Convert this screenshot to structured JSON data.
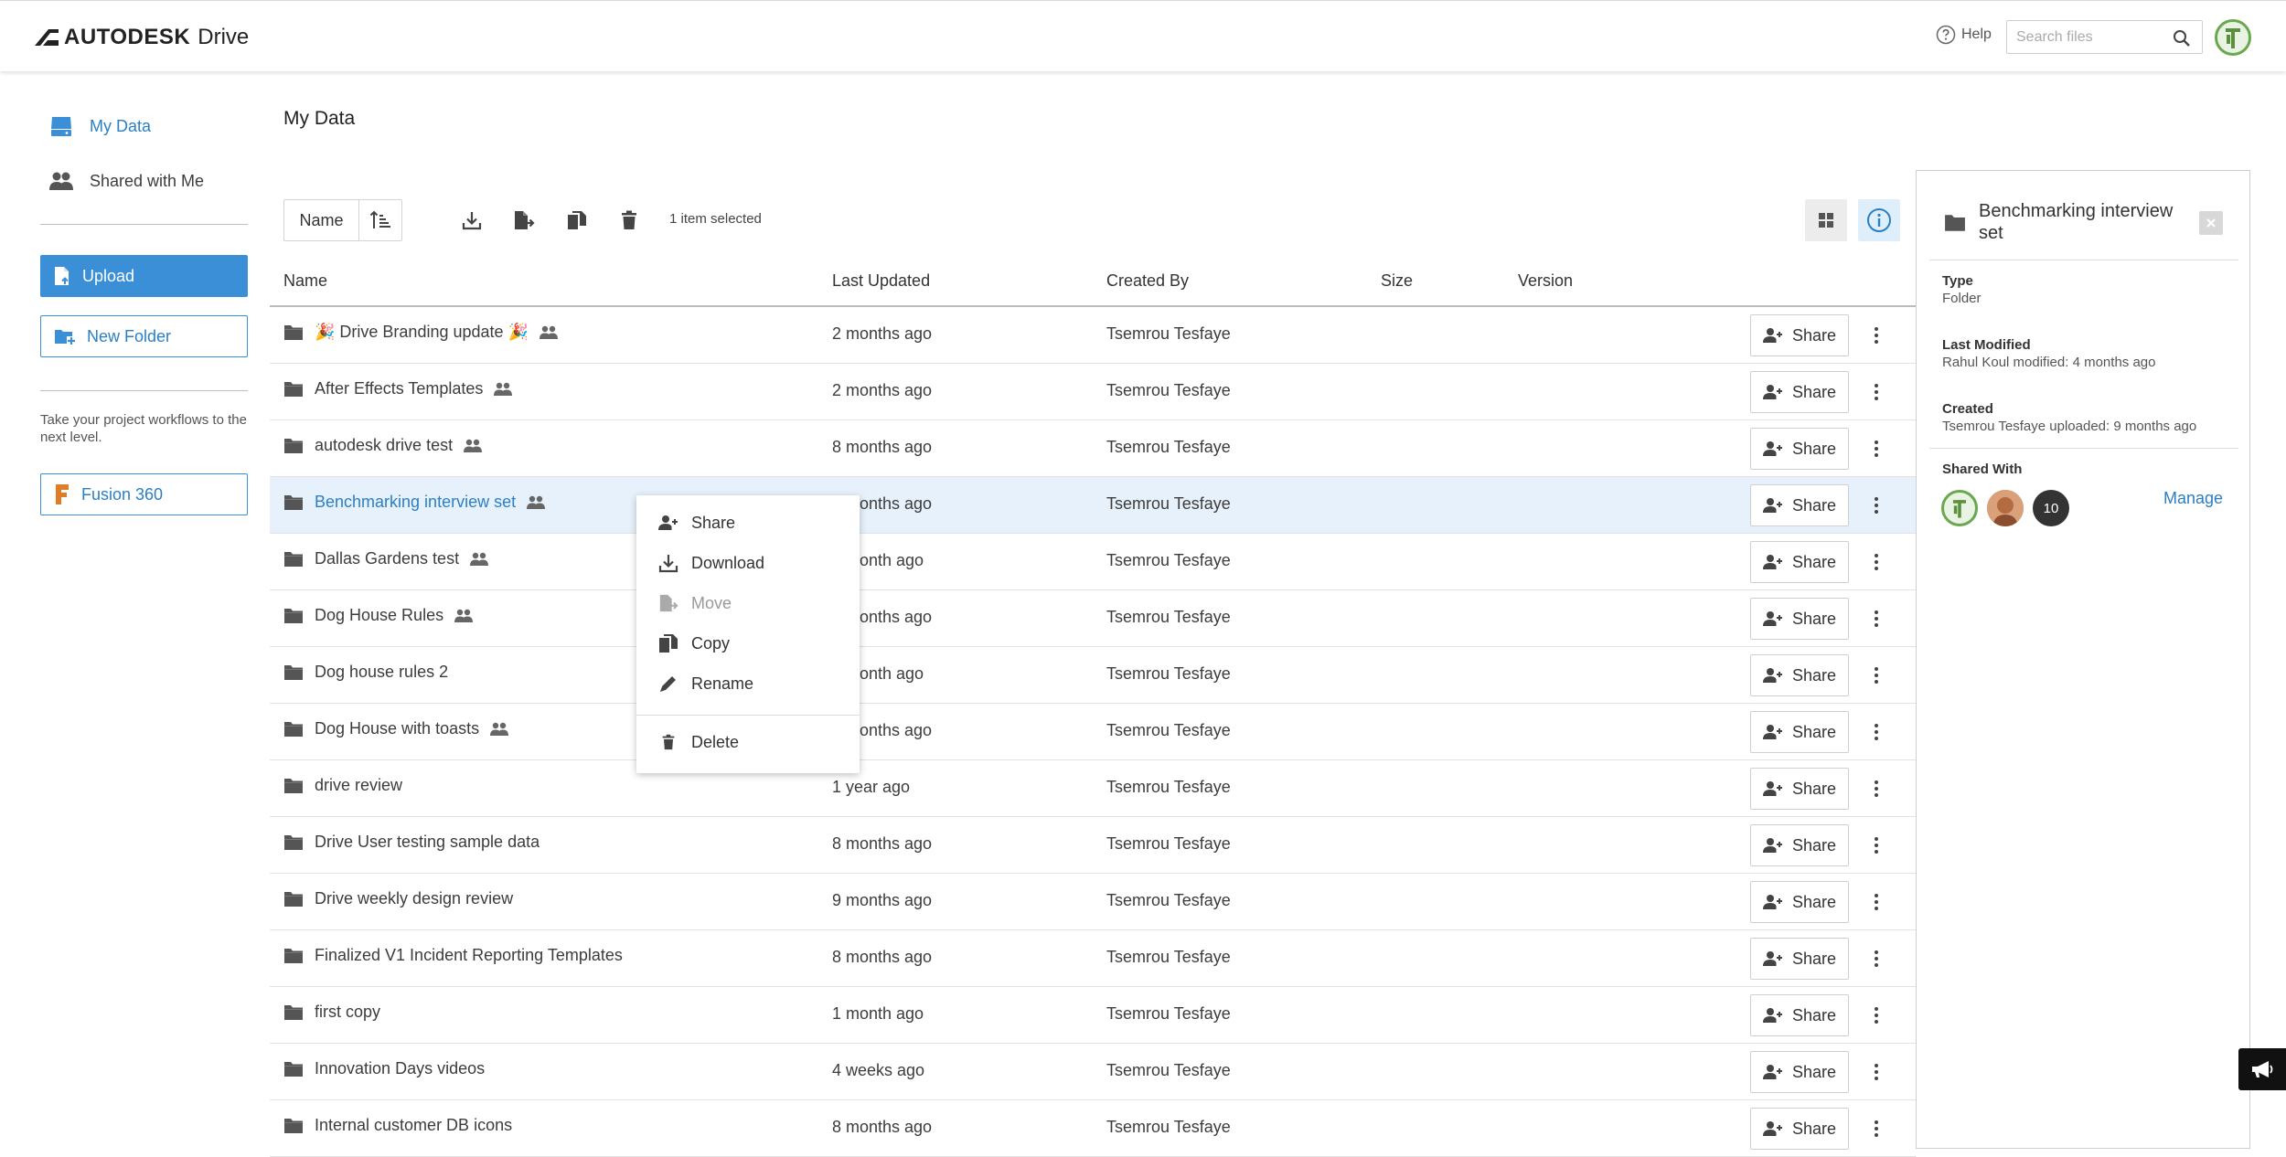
{
  "header": {
    "brand_name": "AUTODESK",
    "product": "Drive",
    "help_label": "Help",
    "search_placeholder": "Search files"
  },
  "sidebar": {
    "nav": [
      {
        "label": "My Data",
        "icon": "drive-icon",
        "active": true
      },
      {
        "label": "Shared with Me",
        "icon": "users-icon",
        "active": false
      }
    ],
    "upload_label": "Upload",
    "new_folder_label": "New Folder",
    "note": "Take your project workflows to the next level.",
    "fusion_label": "Fusion 360"
  },
  "main": {
    "title": "My Data",
    "sort_label": "Name",
    "selection_status": "1 item selected",
    "columns": [
      "Name",
      "Last Updated",
      "Created By",
      "Size",
      "Version"
    ],
    "share_label": "Share",
    "rows": [
      {
        "name": "🎉 Drive Branding update 🎉",
        "updated": "2 months ago",
        "creator": "Tsemrou Tesfaye",
        "shared": true,
        "selected": false
      },
      {
        "name": "After Effects Templates",
        "updated": "2 months ago",
        "creator": "Tsemrou Tesfaye",
        "shared": true,
        "selected": false
      },
      {
        "name": "autodesk drive test",
        "updated": "8 months ago",
        "creator": "Tsemrou Tesfaye",
        "shared": true,
        "selected": false
      },
      {
        "name": "Benchmarking interview set",
        "updated": "4 months ago",
        "creator": "Tsemrou Tesfaye",
        "shared": true,
        "selected": true
      },
      {
        "name": "Dallas Gardens test",
        "updated": "1 month ago",
        "creator": "Tsemrou Tesfaye",
        "shared": true,
        "selected": false
      },
      {
        "name": "Dog House Rules",
        "updated": "2 months ago",
        "creator": "Tsemrou Tesfaye",
        "shared": true,
        "selected": false
      },
      {
        "name": "Dog house rules 2",
        "updated": "1 month ago",
        "creator": "Tsemrou Tesfaye",
        "shared": false,
        "selected": false
      },
      {
        "name": "Dog House with toasts",
        "updated": "2 months ago",
        "creator": "Tsemrou Tesfaye",
        "shared": true,
        "selected": false
      },
      {
        "name": "drive review",
        "updated": "1 year ago",
        "creator": "Tsemrou Tesfaye",
        "shared": false,
        "selected": false
      },
      {
        "name": "Drive User testing sample data",
        "updated": "8 months ago",
        "creator": "Tsemrou Tesfaye",
        "shared": false,
        "selected": false
      },
      {
        "name": "Drive weekly design review",
        "updated": "9 months ago",
        "creator": "Tsemrou Tesfaye",
        "shared": false,
        "selected": false
      },
      {
        "name": "Finalized V1 Incident Reporting Templates",
        "updated": "8 months ago",
        "creator": "Tsemrou Tesfaye",
        "shared": false,
        "selected": false
      },
      {
        "name": "first copy",
        "updated": "1 month ago",
        "creator": "Tsemrou Tesfaye",
        "shared": false,
        "selected": false
      },
      {
        "name": "Innovation Days videos",
        "updated": "4 weeks ago",
        "creator": "Tsemrou Tesfaye",
        "shared": false,
        "selected": false
      },
      {
        "name": "Internal customer DB icons",
        "updated": "8 months ago",
        "creator": "Tsemrou Tesfaye",
        "shared": false,
        "selected": false
      }
    ]
  },
  "context_menu": {
    "items": [
      {
        "label": "Share",
        "icon": "share-user-icon",
        "disabled": false
      },
      {
        "label": "Download",
        "icon": "download-icon",
        "disabled": false
      },
      {
        "label": "Move",
        "icon": "move-icon",
        "disabled": true
      },
      {
        "label": "Copy",
        "icon": "copy-icon",
        "disabled": false
      },
      {
        "label": "Rename",
        "icon": "pencil-icon",
        "disabled": false
      },
      {
        "label": "Delete",
        "icon": "trash-icon",
        "disabled": false
      }
    ]
  },
  "details": {
    "title": "Benchmarking interview set",
    "type_label": "Type",
    "type_value": "Folder",
    "modified_label": "Last Modified",
    "modified_value": "Rahul Koul modified: 4 months ago",
    "created_label": "Created",
    "created_value": "Tsemrou Tesfaye uploaded: 9 months ago",
    "shared_label": "Shared With",
    "shared_extra_count": "10",
    "manage_label": "Manage"
  },
  "colors": {
    "accent": "#3a8fd6",
    "link": "#2b7fc4",
    "selected_row": "#e7f1fb"
  }
}
